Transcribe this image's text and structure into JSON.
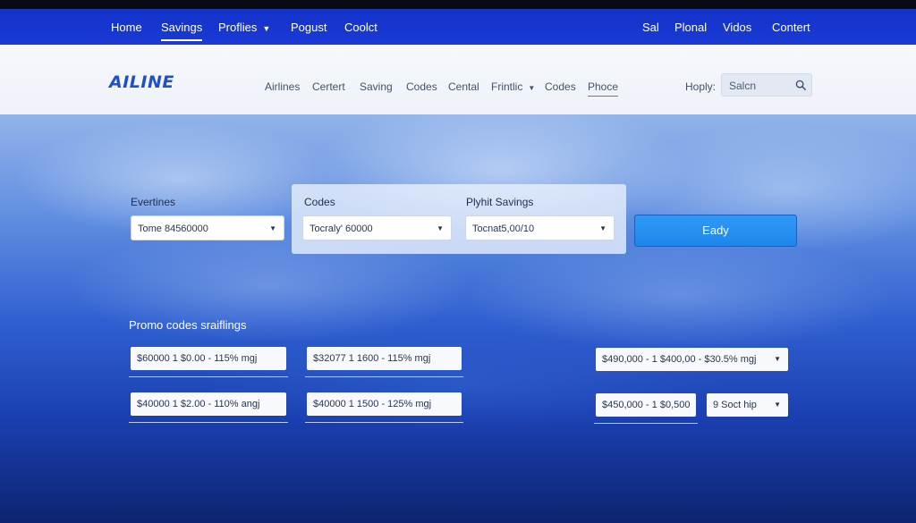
{
  "topnav": {
    "items": [
      "Home",
      "Savings",
      "Proflies",
      "Pogust",
      "Coolct"
    ],
    "right_items": [
      "Sal",
      "Plonal",
      "Vidos",
      "Contert"
    ],
    "active": "Savings"
  },
  "brand": {
    "logo": "AILINE"
  },
  "subnav": {
    "items": [
      "Airlines",
      "Certert",
      "Saving",
      "Codes",
      "Cental",
      "Frintlic",
      "Codes",
      "Phoce"
    ],
    "help_label": "Hoply:",
    "search_placeholder": "Salcn"
  },
  "form": {
    "field1_label": "Evertines",
    "field1_value": "Tome 84560000",
    "field2_label": "Codes",
    "field2_value": "Tocraly' 60000",
    "field3_label": "Plyhit Savings",
    "field3_value": "Tocnat5,00/10",
    "apply_label": "Eady"
  },
  "promo": {
    "title": "Promo codes sraiflings",
    "codes": [
      "$60000  1 $0.00 - 115% mgj",
      "$32077  1 1600 - 115% mgj",
      "$490,000 - 1 $400,00 - $30.5% mgj",
      "$40000  1 $2.00 - 110% angj",
      "$40000  1 1500 - 125% mgj",
      "$450,000 - 1 $0,500",
      "9  Soct hip"
    ]
  },
  "colors": {
    "topnav_bg": "#1432c8",
    "accent_button": "#2f9af5",
    "logo": "#1f50c8"
  }
}
